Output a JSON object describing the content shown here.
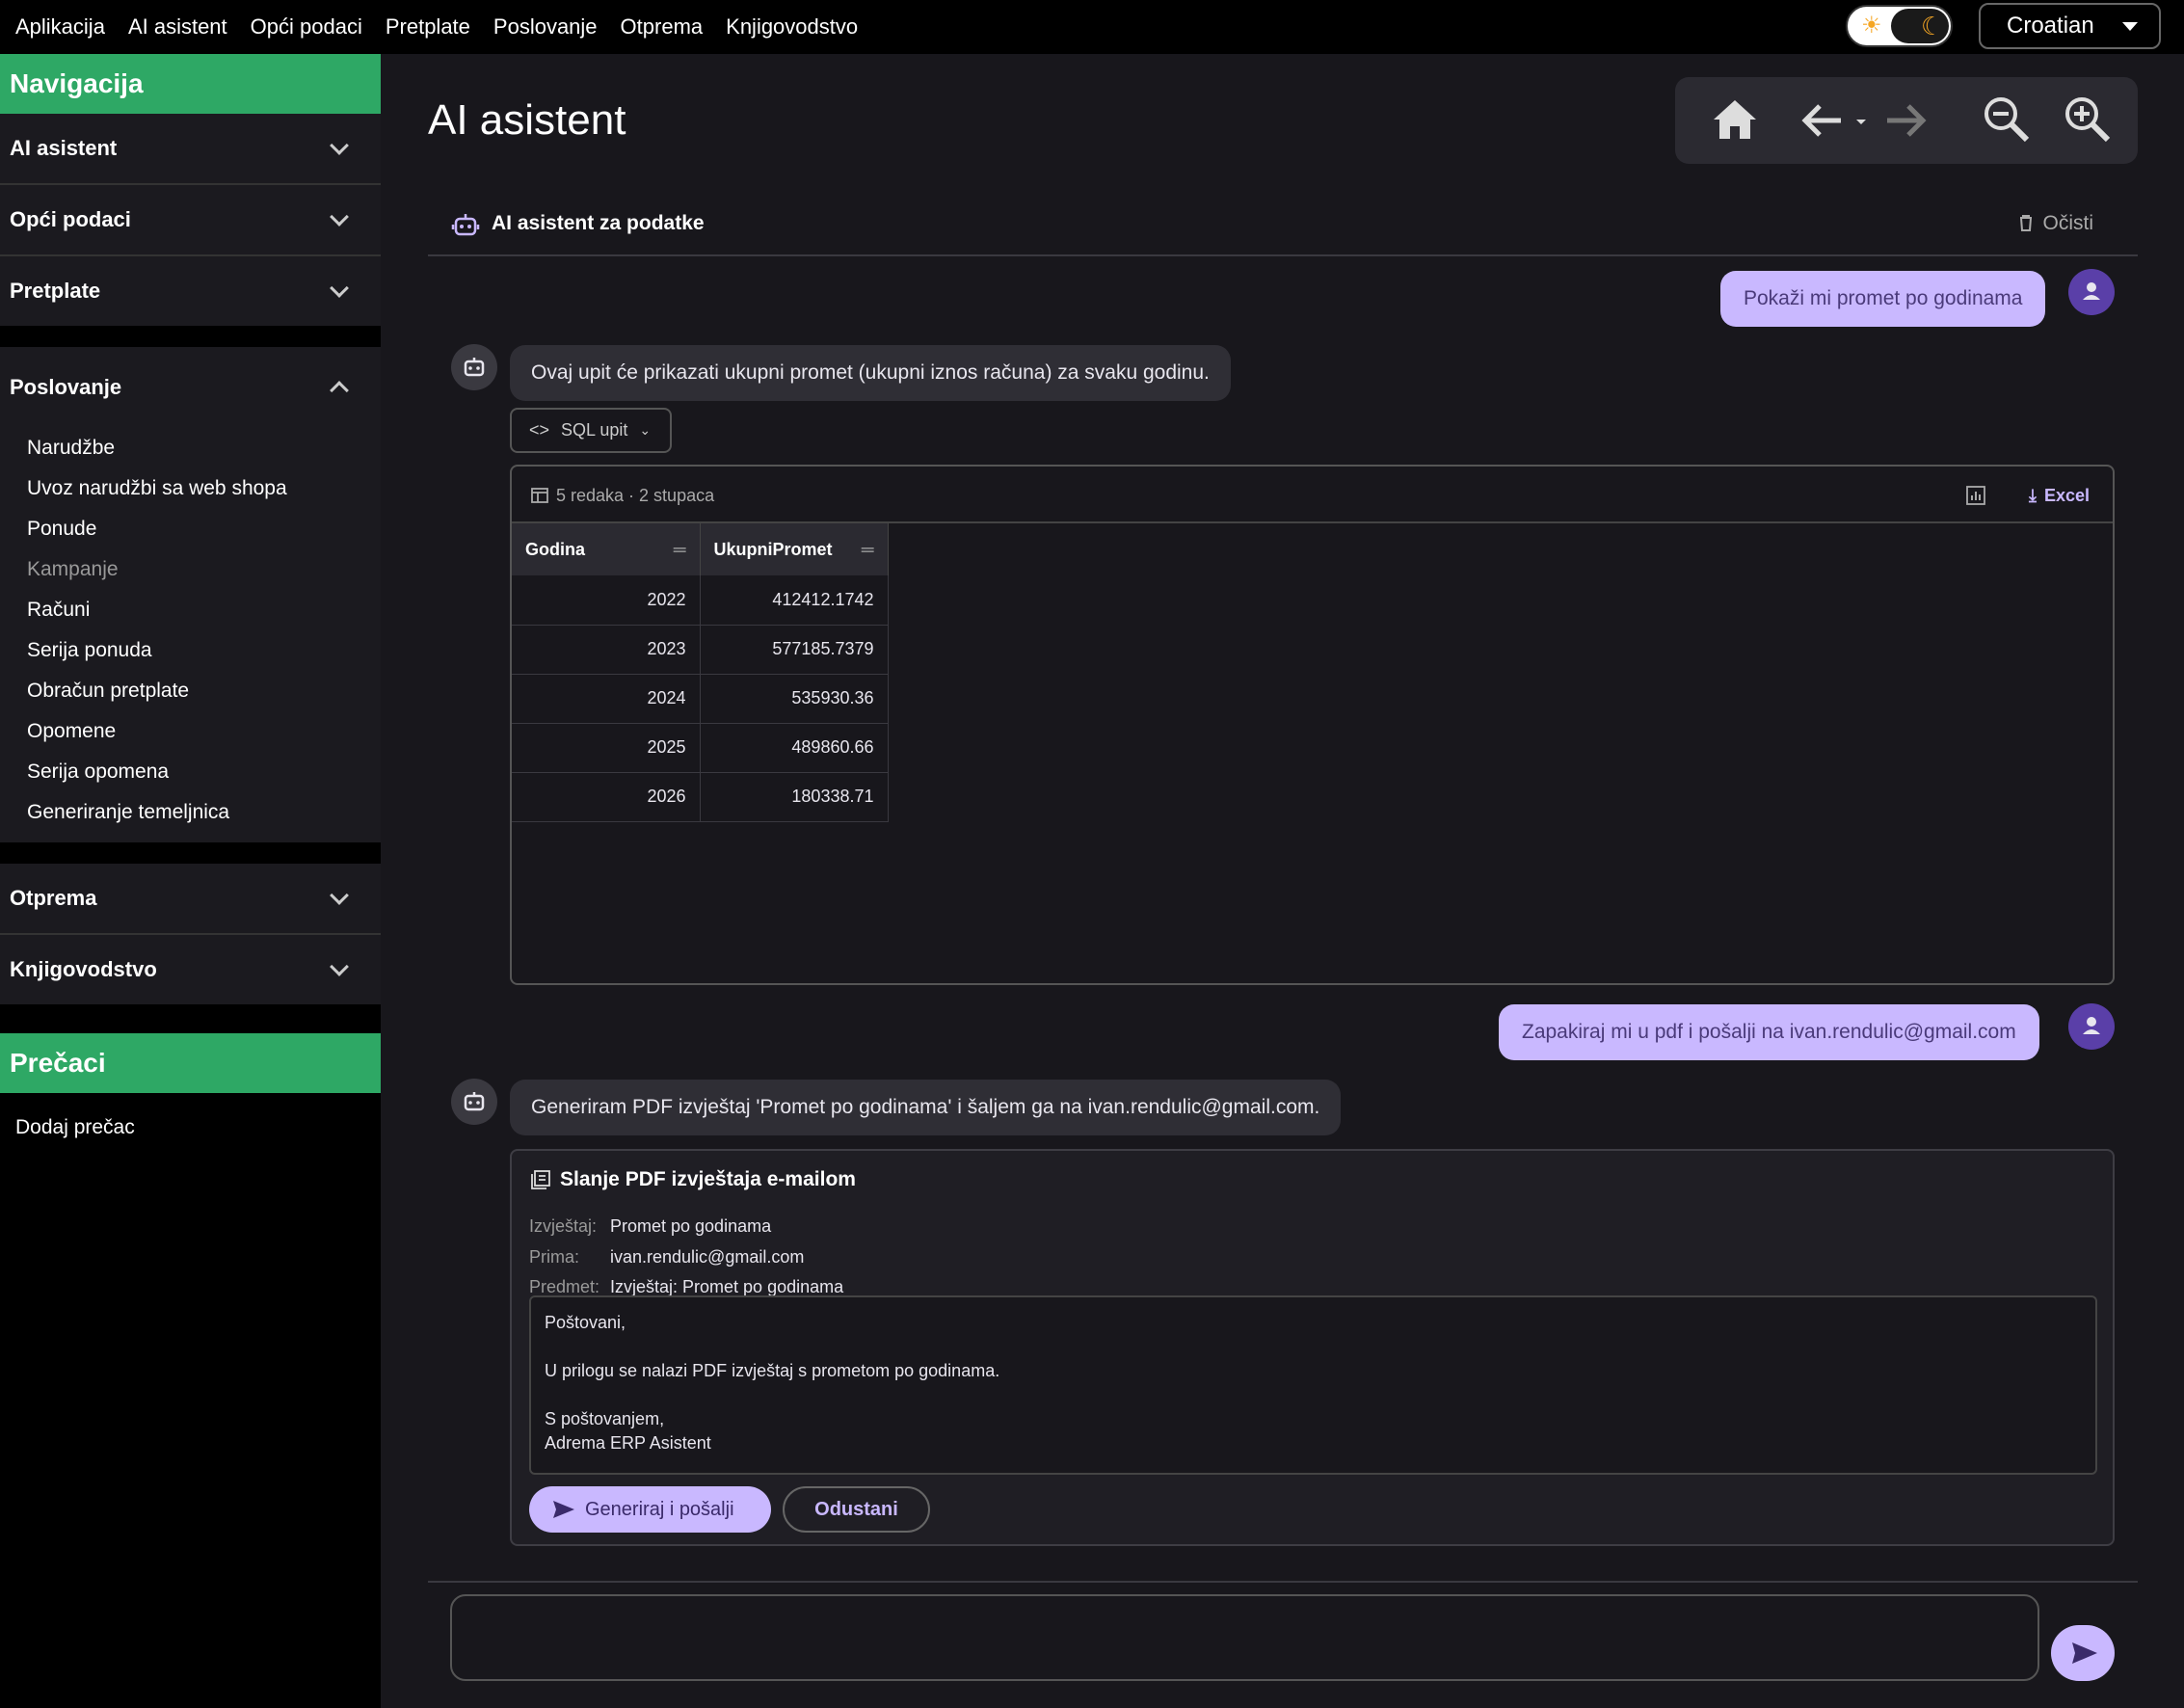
{
  "topbar": {
    "menu": [
      "Aplikacija",
      "AI asistent",
      "Opći podaci",
      "Pretplate",
      "Poslovanje",
      "Otprema",
      "Knjigovodstvo"
    ],
    "theme_toggle": {
      "sun_icon": "sun-icon",
      "moon_icon": "moon-icon"
    },
    "language": "Croatian"
  },
  "sidebar": {
    "nav_title": "Navigacija",
    "sections": [
      "AI asistent",
      "Opći podaci",
      "Pretplate",
      "Poslovanje",
      "Otprema",
      "Knjigovodstvo"
    ],
    "poslovanje_items": [
      "Narudžbe",
      "Uvoz narudžbi sa web shopa",
      "Ponude",
      "Kampanje",
      "Računi",
      "Serija ponuda",
      "Obračun pretplate",
      "Opomene",
      "Serija opomena",
      "Generiranje temeljnica"
    ],
    "shortcuts_title": "Prečaci",
    "add_shortcut": "Dodaj prečac"
  },
  "main": {
    "page_title": "AI asistent",
    "toolbar_icons": [
      "home-icon",
      "back-icon",
      "forward-icon",
      "zoom-out-icon",
      "zoom-in-icon"
    ],
    "chat_title": "AI asistent za podatke",
    "clear_label": "Očisti",
    "messages": {
      "user1": "Pokaži mi promet po godinama",
      "bot1": "Ovaj upit će prikazati ukupni promet (ukupni iznos računa) za svaku godinu.",
      "sql_label": "SQL upit",
      "user2": "Zapakiraj mi u pdf i pošalji na ivan.rendulic@gmail.com",
      "bot2": "Generiram PDF izvještaj 'Promet po godinama' i šaljem ga na ivan.rendulic@gmail.com."
    },
    "result": {
      "meta": "5 redaka · 2 stupaca",
      "excel_label": "Excel",
      "columns": [
        "Godina",
        "UkupniPromet"
      ],
      "rows": [
        [
          "2022",
          "412412.1742"
        ],
        [
          "2023",
          "577185.7379"
        ],
        [
          "2024",
          "535930.36"
        ],
        [
          "2025",
          "489860.66"
        ],
        [
          "2026",
          "180338.71"
        ]
      ]
    },
    "email": {
      "title": "Slanje PDF izvještaja e-mailom",
      "report_label": "Izvještaj:",
      "report_value": "Promet po godinama",
      "to_label": "Prima:",
      "to_value": "ivan.rendulic@gmail.com",
      "subject_label": "Predmet:",
      "subject_value": "Izvještaj: Promet po godinama",
      "body_line1": "Poštovani,",
      "body_line2": "U prilogu se nalazi PDF izvještaj s prometom po godinama.",
      "body_line3": "S poštovanjem,",
      "body_line4": "Adrema ERP Asistent",
      "send_label": "Generiraj i pošalji",
      "cancel_label": "Odustani"
    },
    "composer": {
      "placeholder": ""
    }
  },
  "colors": {
    "accent": "#c9b8ff",
    "sidebar_header": "#2ea865",
    "avatar_user": "#5a3fa8"
  }
}
